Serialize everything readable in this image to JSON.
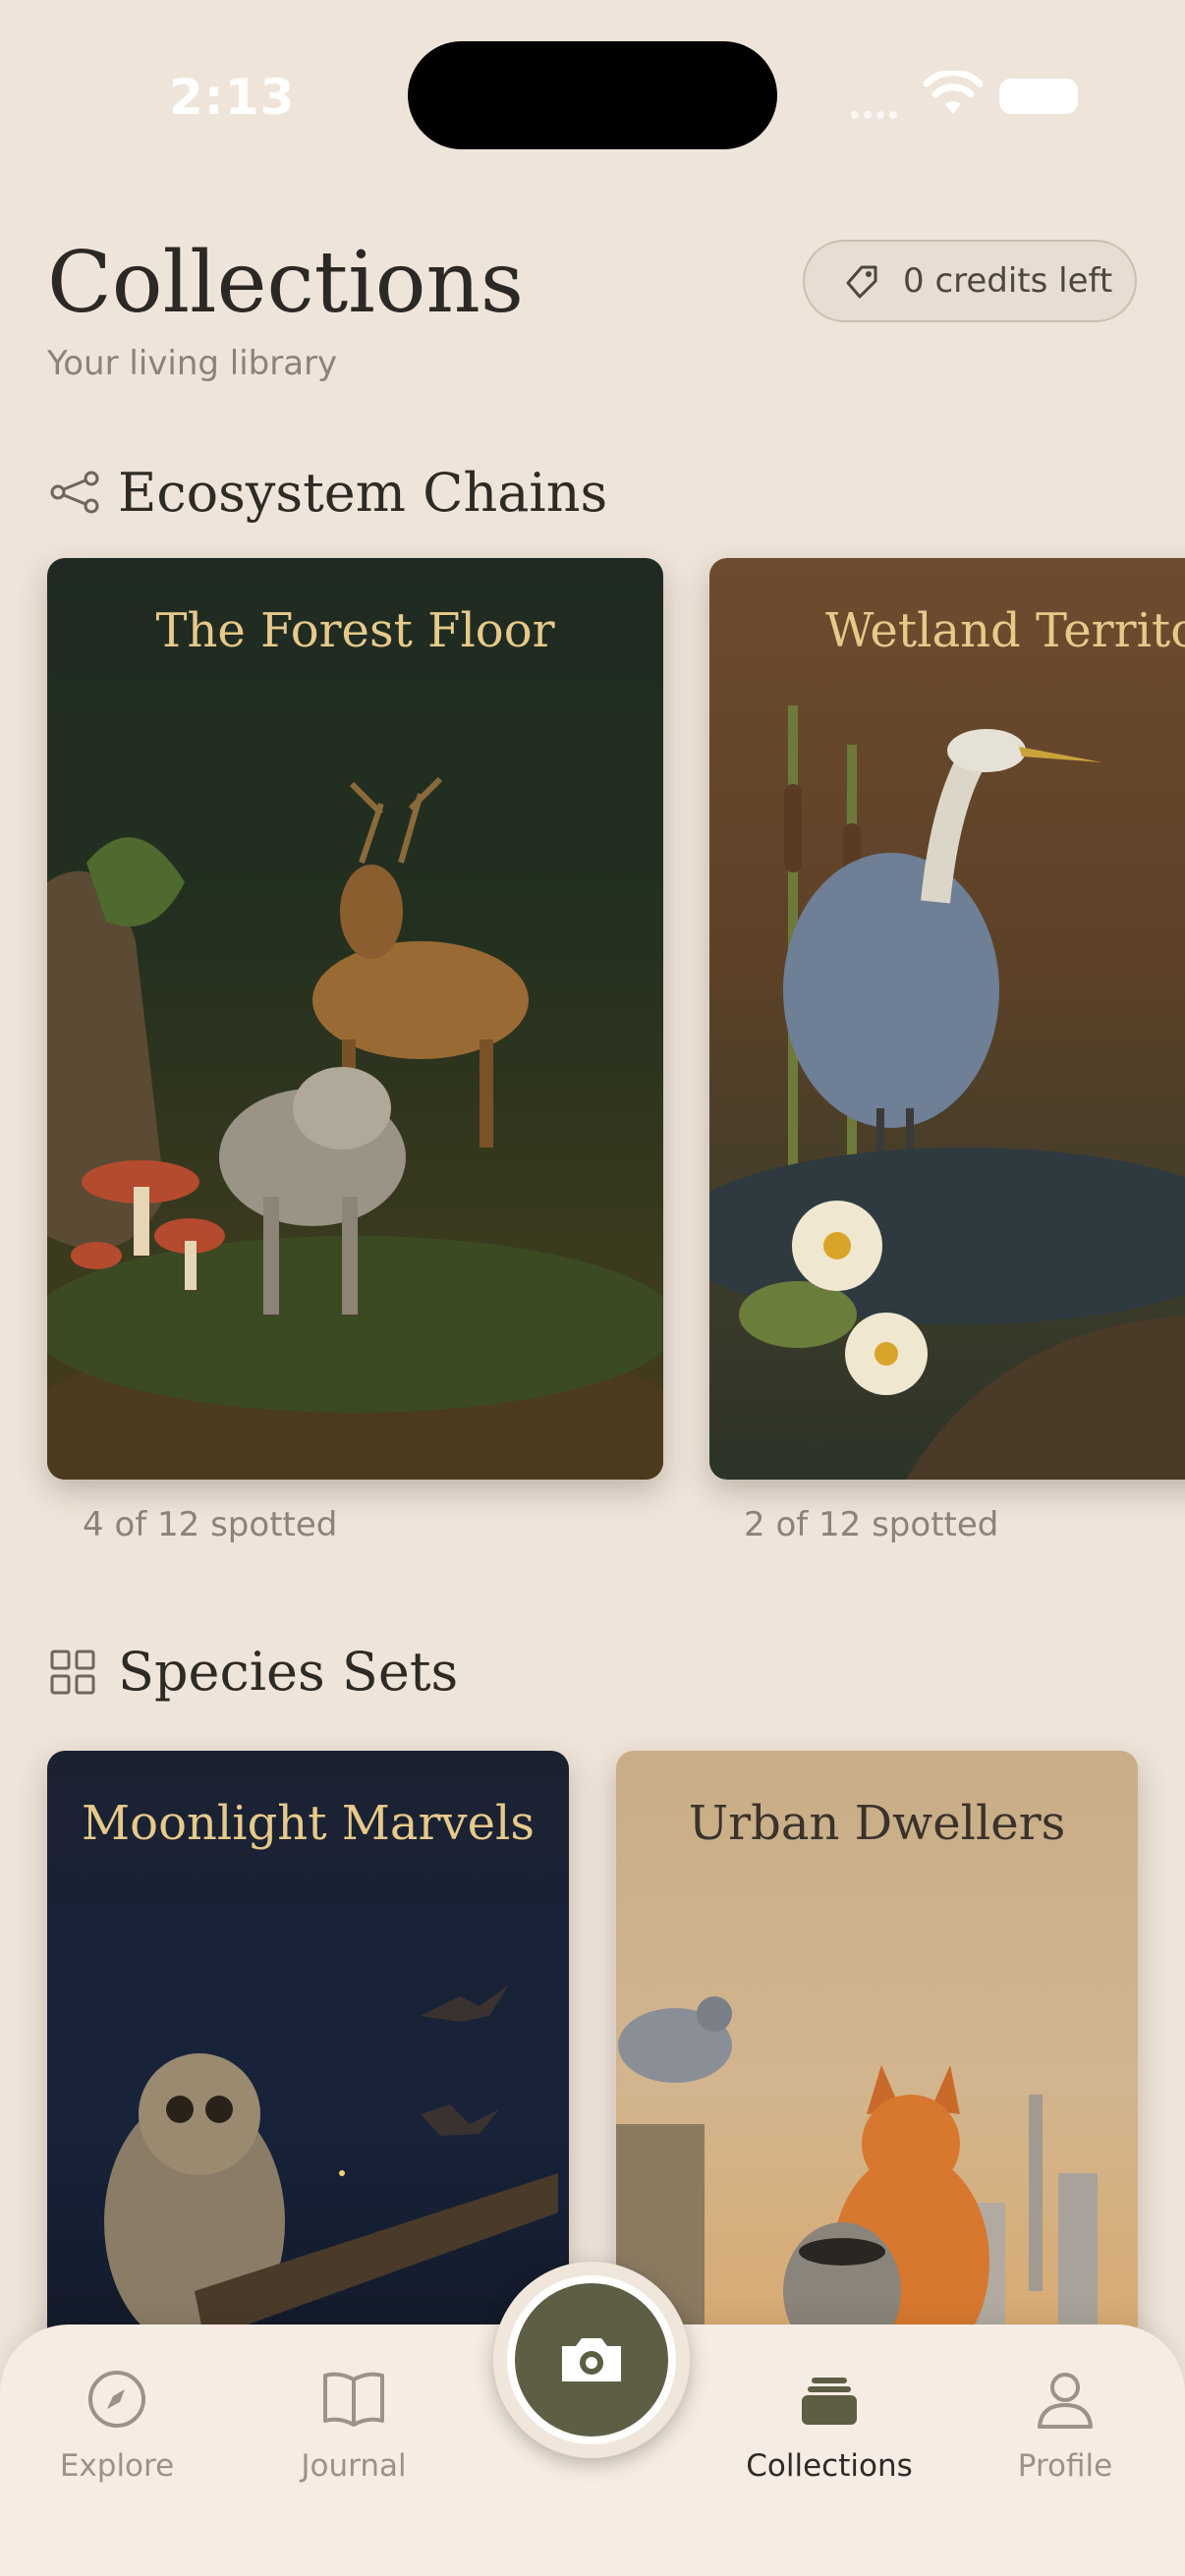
{
  "status_bar": {
    "time": "2:13"
  },
  "header": {
    "title": "Collections",
    "subtitle": "Your living library",
    "credits": "0 credits left"
  },
  "sections": {
    "ecosystem": {
      "title": "Ecosystem Chains",
      "cards": [
        {
          "title": "The Forest Floor",
          "spotted": "4 of 12 spotted"
        },
        {
          "title": "Wetland Territory",
          "spotted": "2 of 12 spotted"
        }
      ]
    },
    "species": {
      "title": "Species Sets",
      "cards": [
        {
          "title": "Moonlight Marvels"
        },
        {
          "title": "Urban Dwellers"
        }
      ]
    }
  },
  "tabs": [
    {
      "label": "Explore",
      "icon": "compass-icon"
    },
    {
      "label": "Journal",
      "icon": "book-icon"
    },
    {
      "label": "Collections",
      "icon": "stack-icon",
      "active": true
    },
    {
      "label": "Profile",
      "icon": "person-icon"
    }
  ],
  "colors": {
    "background": "#efe4d9",
    "accent": "#5d5e44",
    "forest": "#1f2a20",
    "wetland": "#6b4a2f",
    "moonlight": "#1b2334",
    "urban": "#c9ab84"
  }
}
